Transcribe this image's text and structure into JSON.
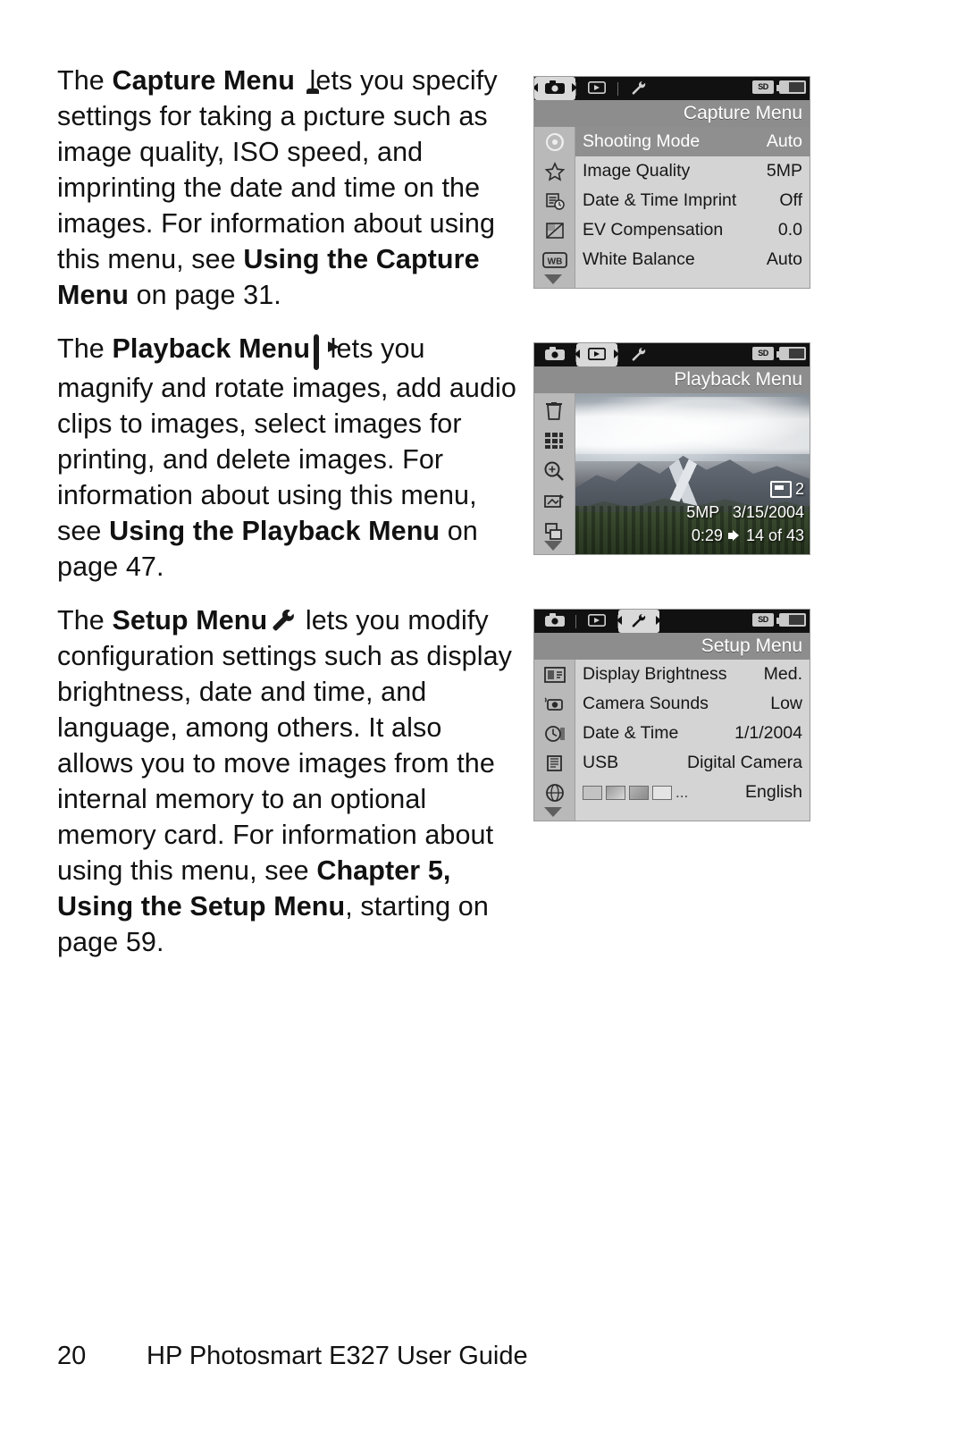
{
  "body": {
    "para1": {
      "t1": "The ",
      "b1": "Capture Menu",
      "icon1": "camera-icon",
      "t2": " lets you specify settings for taking a picture such as image quality, ISO speed, and imprinting the date and time on the images. For information about using this menu, see ",
      "b2": "Using the Capture Menu",
      "t3": " on page 31."
    },
    "para2": {
      "t1": "The ",
      "b1": "Playback Menu",
      "icon1": "playback-icon",
      "t2": " lets you magnify and rotate images, add audio clips to images, select images for printing, and delete images. For information about using this menu, see ",
      "b2": "Using the Playback Menu",
      "t3": " on page 47."
    },
    "para3": {
      "t1": "The ",
      "b1": "Setup Menu",
      "icon1": "wrench-icon",
      "t2": " lets you modify configuration settings such as display brightness, date and time, and language, among others. It also allows you to move images from the internal memory to an optional memory card. For information about using this menu, see ",
      "b2": "Chapter 5, Using the Setup Menu",
      "t3": ", starting on page 59."
    }
  },
  "screens": {
    "capture": {
      "title": "Capture Menu",
      "tabs": [
        {
          "name": "tab-capture",
          "glyph": "■",
          "selected": true
        },
        {
          "name": "tab-playback",
          "glyph": "▶",
          "selected": false
        },
        {
          "name": "tab-setup",
          "glyph": "⚒",
          "selected": false
        }
      ],
      "status": {
        "card": "SD",
        "battery": "battery-icon"
      },
      "rows": [
        {
          "icon": "shooting-mode-icon",
          "label": "Shooting Mode",
          "value": "Auto",
          "highlighted": true
        },
        {
          "icon": "star-icon",
          "label": "Image Quality",
          "value": "5MP",
          "highlighted": false
        },
        {
          "icon": "date-time-imprint-icon",
          "label": "Date & Time Imprint",
          "value": "Off",
          "highlighted": false
        },
        {
          "icon": "ev-compensation-icon",
          "label": "EV Compensation",
          "value": "0.0",
          "highlighted": false
        },
        {
          "icon": "white-balance-icon",
          "label": "White Balance",
          "value": "Auto",
          "highlighted": false
        }
      ]
    },
    "playback": {
      "title": "Playback Menu",
      "tabs": [
        {
          "name": "tab-capture",
          "glyph": "■",
          "selected": false
        },
        {
          "name": "tab-playback",
          "glyph": "▶",
          "selected": true
        },
        {
          "name": "tab-setup",
          "glyph": "⚒",
          "selected": false
        }
      ],
      "status": {
        "card": "SD",
        "battery": "battery-icon"
      },
      "rail_icons": [
        "trash-icon",
        "thumbnails-icon",
        "magnify-icon",
        "rotate-icon",
        "print-icon"
      ],
      "overlay": {
        "print_count": "2",
        "resolution": "5MP",
        "date": "3/15/2004",
        "audio_length": "0:29",
        "counter": "14 of 43"
      }
    },
    "setup": {
      "title": "Setup Menu",
      "tabs": [
        {
          "name": "tab-capture",
          "glyph": "■",
          "selected": false
        },
        {
          "name": "tab-playback",
          "glyph": "▶",
          "selected": false
        },
        {
          "name": "tab-setup",
          "glyph": "⚒",
          "selected": true
        }
      ],
      "status": {
        "card": "SD",
        "battery": "battery-icon"
      },
      "rows": [
        {
          "icon": "display-brightness-icon",
          "label": "Display Brightness",
          "value": "Med.",
          "highlighted": false
        },
        {
          "icon": "camera-sounds-icon",
          "label": "Camera Sounds",
          "value": "Low",
          "highlighted": false
        },
        {
          "icon": "date-time-icon",
          "label": "Date & Time",
          "value": "1/1/2004",
          "highlighted": false
        },
        {
          "icon": "usb-icon",
          "label": "USB",
          "value": "Digital Camera",
          "highlighted": false
        },
        {
          "icon": "language-globe-icon",
          "label": "",
          "value": "English",
          "highlighted": false
        }
      ]
    }
  },
  "footer": {
    "page_number": "20",
    "text": "HP Photosmart E327 User Guide"
  }
}
